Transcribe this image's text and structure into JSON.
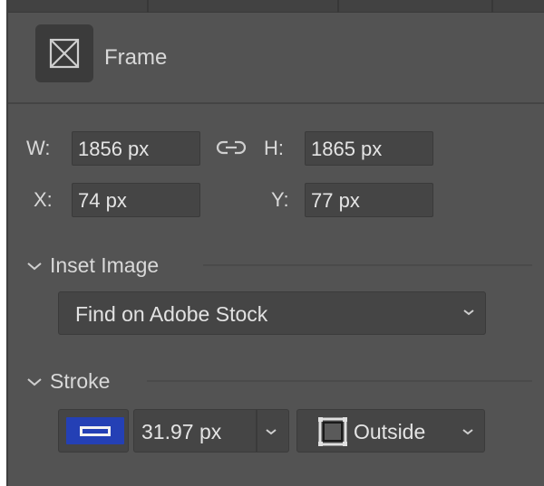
{
  "header": {
    "title": "Frame",
    "icon": "frame-icon"
  },
  "transform": {
    "w_label": "W:",
    "w_value": "1856 px",
    "h_label": "H:",
    "h_value": "1865 px",
    "x_label": "X:",
    "x_value": "74 px",
    "y_label": "Y:",
    "y_value": "77 px",
    "link_icon": "link-icon"
  },
  "inset_image": {
    "label": "Inset Image",
    "dropdown_value": "Find on Adobe Stock"
  },
  "stroke": {
    "label": "Stroke",
    "color": "#2440b5",
    "weight": "31.97 px",
    "position": "Outside"
  }
}
